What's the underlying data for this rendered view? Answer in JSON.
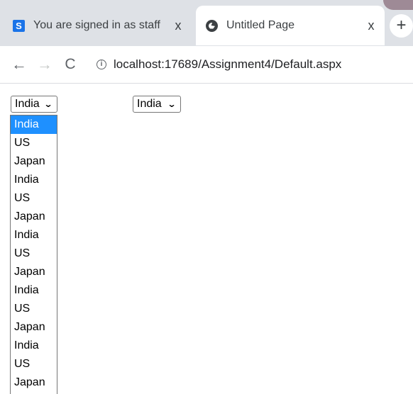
{
  "tabs": [
    {
      "favicon": "s-icon",
      "title": "You are signed in as staff",
      "close": "x"
    },
    {
      "favicon": "globe-icon",
      "title": "Untitled Page",
      "close": "x"
    }
  ],
  "new_tab": "+",
  "nav": {
    "back": "←",
    "forward": "→",
    "reload": "C"
  },
  "address": {
    "info": "i",
    "url": "localhost:17689/Assignment4/Default.aspx"
  },
  "dropdown1": {
    "value": "India",
    "options": [
      "India",
      "US",
      "Japan",
      "India",
      "US",
      "Japan",
      "India",
      "US",
      "Japan",
      "India",
      "US",
      "Japan",
      "India",
      "US",
      "Japan"
    ],
    "highlighted_index": 0
  },
  "dropdown2": {
    "value": "India"
  },
  "colors": {
    "highlight": "#1e90ff",
    "tabstrip": "#dee1e6"
  }
}
